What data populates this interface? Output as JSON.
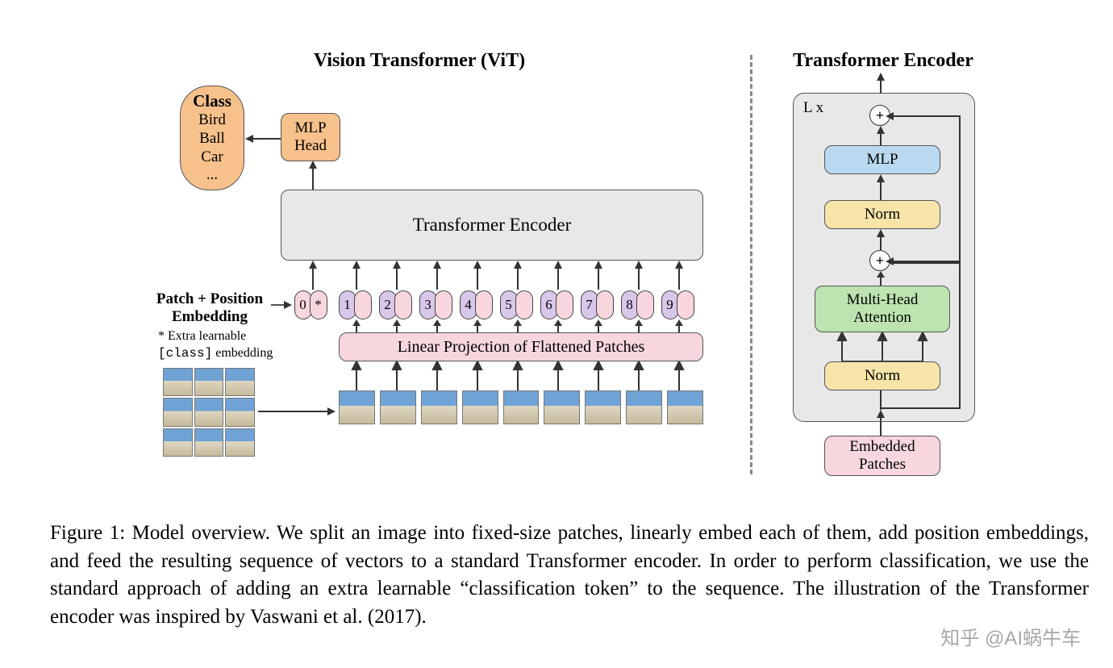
{
  "left": {
    "title": "Vision Transformer (ViT)",
    "class_label": "Class",
    "class_items": [
      "Bird",
      "Ball",
      "Car",
      "..."
    ],
    "mlp_head": "MLP\nHead",
    "encoder": "Transformer Encoder",
    "pp_label": "Patch + Position\nEmbedding",
    "extra_note_prefix": "* Extra learnable",
    "extra_note_class": "[class]",
    "extra_note_suffix": " embedding",
    "linear_proj": "Linear Projection of Flattened Patches",
    "tokens": [
      "0",
      "*",
      "1",
      "2",
      "3",
      "4",
      "5",
      "6",
      "7",
      "8",
      "9"
    ]
  },
  "right": {
    "title": "Transformer Encoder",
    "lx": "L x",
    "mlp": "MLP",
    "norm1": "Norm",
    "mha": "Multi-Head\nAttention",
    "norm2": "Norm",
    "embedded": "Embedded\nPatches",
    "plus": "+"
  },
  "caption": "Figure 1: Model overview. We split an image into fixed-size patches, linearly embed each of them, add position embeddings, and feed the resulting sequence of vectors to a standard Transformer encoder. In order to perform classification, we use the standard approach of adding an extra learnable “classification token” to the sequence. The illustration of the Transformer encoder was inspired by Vaswani et al. (2017).",
  "watermark": "知乎 @AI蜗牛车"
}
